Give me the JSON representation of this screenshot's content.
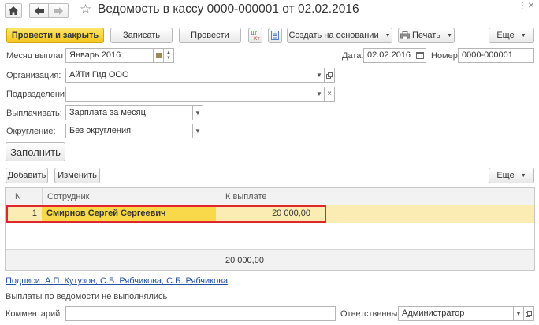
{
  "title": "Ведомость в кассу 0000-000001 от 02.02.2016",
  "window_controls": {
    "more": "⋮",
    "close": "×"
  },
  "toolbar": {
    "post_close": "Провести и закрыть",
    "save": "Записать",
    "post": "Провести",
    "create_based": "Создать на основании",
    "print": "Печать",
    "more": "Еще"
  },
  "form": {
    "month_label": "Месяц выплаты:",
    "month_value": "Январь 2016",
    "date_label": "Дата:",
    "date_value": "02.02.2016",
    "number_label": "Номер:",
    "number_value": "0000-000001",
    "org_label": "Организация:",
    "org_value": "АйТи Гид ООО",
    "dept_label": "Подразделение:",
    "dept_value": "",
    "pay_label": "Выплачивать:",
    "pay_value": "Зарплата за месяц",
    "round_label": "Округление:",
    "round_value": "Без округления",
    "fill_button": "Заполнить"
  },
  "table_toolbar": {
    "add": "Добавить",
    "edit": "Изменить",
    "more": "Еще"
  },
  "table": {
    "columns": [
      "N",
      "Сотрудник",
      "К выплате"
    ],
    "rows": [
      {
        "n": "1",
        "employee": "Смирнов Сергей Сергеевич",
        "amount": "20 000,00"
      }
    ],
    "total": "20 000,00"
  },
  "signatures_link": "Подписи: А.П. Кутузов, С.Б. Рябчикова, С.Б. Рябчикова",
  "status_text": "Выплаты по ведомости не выполнялись",
  "comment_label": "Комментарий:",
  "comment_value": "",
  "responsible_label": "Ответственный:",
  "responsible_value": "Администратор",
  "colors": {
    "primary_button": "#f4c51d",
    "selected_row": "#faecb2",
    "selected_cell": "#f9d94a",
    "highlight_border": "#e0262a",
    "link": "#2452a3"
  }
}
